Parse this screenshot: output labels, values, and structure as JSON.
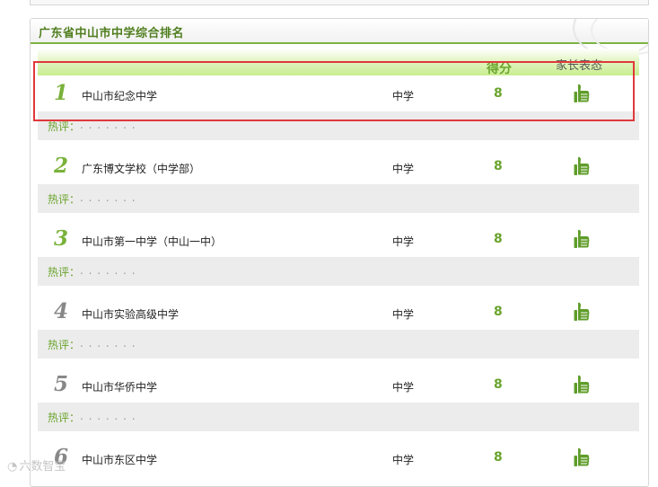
{
  "panel": {
    "title": "广东省中山市中学综合排名",
    "col_score": "得分",
    "col_vote": "家长表态"
  },
  "comment_label": "热评：",
  "comment_placeholder": ". . . . . . .",
  "rows": [
    {
      "rank": "1",
      "name": "中山市纪念中学",
      "type": "中学",
      "score": "8",
      "highlight": true
    },
    {
      "rank": "2",
      "name": "广东博文学校（中学部）",
      "type": "中学",
      "score": "8"
    },
    {
      "rank": "3",
      "name": "中山市第一中学（中山一中）",
      "type": "中学",
      "score": "8"
    },
    {
      "rank": "4",
      "name": "中山市实验高级中学",
      "type": "中学",
      "score": "8"
    },
    {
      "rank": "5",
      "name": "中山市华侨中学",
      "type": "中学",
      "score": "8"
    },
    {
      "rank": "6",
      "name": "中山市东区中学",
      "type": "中学",
      "score": "8"
    }
  ],
  "watermark": "六数智宝",
  "colors": {
    "accent": "#7ab23a",
    "highlight": "#e0383b",
    "comment_bg": "#ececec"
  },
  "icons": {
    "vote": "thumbs-up-icon"
  }
}
